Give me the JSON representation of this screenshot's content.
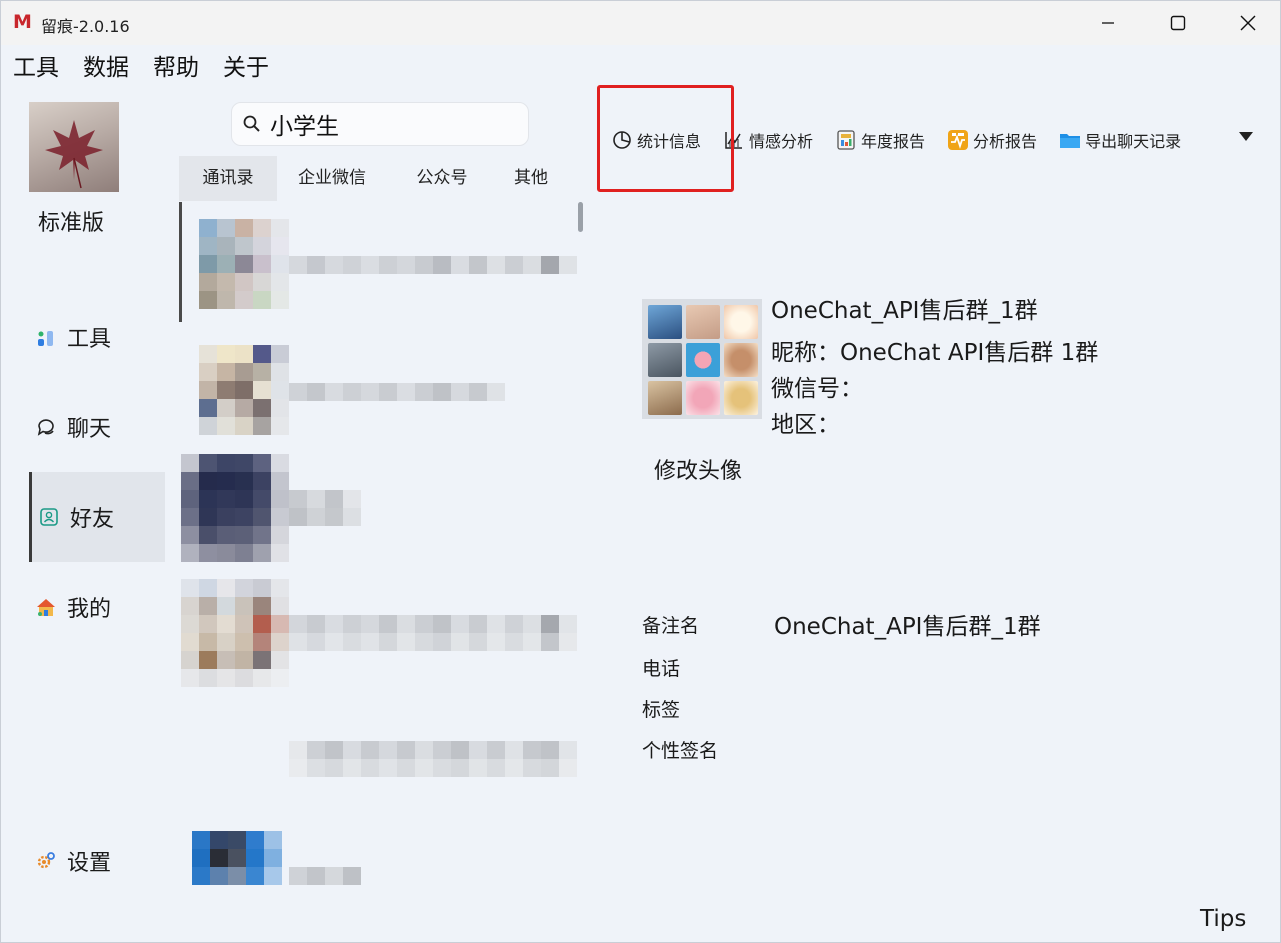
{
  "window": {
    "title": "留痕-2.0.16",
    "logo_letter": "M",
    "accent": "#c8262c"
  },
  "menu": [
    "工具",
    "数据",
    "帮助",
    "关于"
  ],
  "sidebar": {
    "edition": "标准版",
    "items": [
      {
        "label": "工具",
        "icon": "tools-icon"
      },
      {
        "label": "聊天",
        "icon": "chat-icon"
      },
      {
        "label": "好友",
        "icon": "contacts-icon",
        "active": true
      },
      {
        "label": "我的",
        "icon": "home-icon"
      },
      {
        "label": "设置",
        "icon": "gear-icon"
      }
    ]
  },
  "search": {
    "value": "小学生",
    "icon": "search-icon"
  },
  "tabs": [
    {
      "label": "通讯录",
      "active": true
    },
    {
      "label": "企业微信"
    },
    {
      "label": "公众号"
    },
    {
      "label": "其他"
    }
  ],
  "toolbar": [
    {
      "label": "统计信息",
      "icon": "pie-chart-icon",
      "highlighted": true
    },
    {
      "label": "情感分析",
      "icon": "line-chart-icon"
    },
    {
      "label": "年度报告",
      "icon": "report-icon"
    },
    {
      "label": "分析报告",
      "icon": "analysis-icon"
    },
    {
      "label": "导出聊天记录",
      "icon": "folder-icon"
    }
  ],
  "highlight_color": "#e02020",
  "detail": {
    "group_name": "OneChat_API售后群_1群",
    "nickname_line": "昵称：OneChat API售后群 1群",
    "wechat_id_line": "微信号：",
    "region_line": "地区：",
    "change_avatar": "修改头像",
    "fields": [
      {
        "label": "备注名",
        "value": "OneChat_API售后群_1群"
      },
      {
        "label": "电话",
        "value": ""
      },
      {
        "label": "标签",
        "value": ""
      },
      {
        "label": "个性签名",
        "value": ""
      }
    ]
  },
  "footer": {
    "tips": "Tips"
  }
}
